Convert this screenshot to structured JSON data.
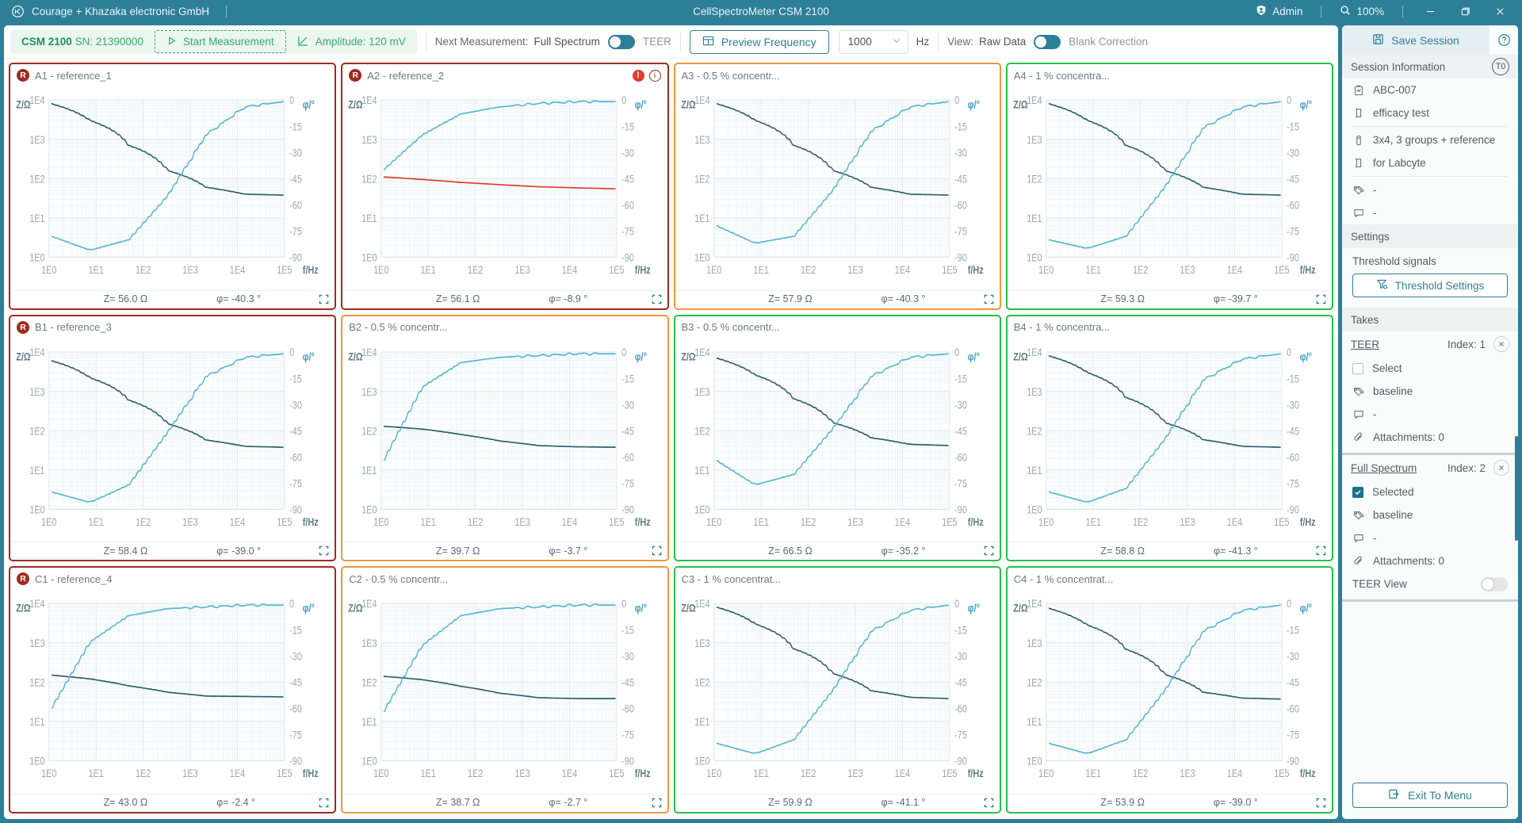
{
  "titlebar": {
    "company": "Courage + Khazaka electronic GmbH",
    "app_title": "CellSpectroMeter CSM 2100",
    "user": "Admin",
    "zoom": "100%",
    "minimize_icon": "minimize-icon",
    "maximize_icon": "maximize-icon",
    "close_icon": "close-icon"
  },
  "toolbar": {
    "device": "CSM 2100",
    "serial": "SN: 21390000",
    "start_label": "Start Measurement",
    "amplitude_label": "Amplitude: 120 mV",
    "next_measurement_label": "Next Measurement:",
    "next_measurement_left": "Full Spectrum",
    "next_measurement_right": "TEER",
    "preview_frequency_label": "Preview Frequency",
    "frequency_value": "1000",
    "frequency_unit": "Hz",
    "view_label": "View:",
    "view_left": "Raw Data",
    "view_right": "Blank Correction"
  },
  "sidebar": {
    "save_label": "Save Session",
    "help_icon": "help-icon",
    "session_information_title": "Session Information",
    "t0_badge": "T0",
    "info_rows": [
      {
        "icon": "study-icon",
        "text": "ABC-007"
      },
      {
        "icon": "note-icon",
        "text": "efficacy test"
      },
      {
        "icon": "plate-icon",
        "text": "3x4, 3 groups + reference"
      },
      {
        "icon": "note-icon",
        "text": "for Labcyte"
      },
      {
        "icon": "tag-icon",
        "text": "-"
      },
      {
        "icon": "comment-icon",
        "text": "-"
      }
    ],
    "settings_title": "Settings",
    "threshold_signals_label": "Threshold signals",
    "threshold_settings_label": "Threshold Settings",
    "takes_title": "Takes",
    "takes": [
      {
        "name": "TEER",
        "index_label": "Index: 1",
        "selected": false,
        "select_label": "Select",
        "tag": "baseline",
        "comment": "-",
        "attachments": "Attachments: 0"
      },
      {
        "name": "Full Spectrum",
        "index_label": "Index: 2",
        "selected": true,
        "select_label": "Selected",
        "tag": "baseline",
        "comment": "-",
        "attachments": "Attachments: 0",
        "teer_view_label": "TEER View",
        "teer_view_on": false
      }
    ],
    "exit_label": "Exit To Menu"
  },
  "chart_common": {
    "y_left_label": "Z/Ω",
    "y_right_label": "φ/°",
    "x_label": "f/Hz",
    "y_left_ticks": [
      "1E4",
      "1E3",
      "1E2",
      "1E1",
      "1E0"
    ],
    "y_right_ticks": [
      "0",
      "-15",
      "-30",
      "-45",
      "-60",
      "-75",
      "-90"
    ],
    "x_ticks": [
      "1E0",
      "1E1",
      "1E2",
      "1E3",
      "1E4",
      "1E5"
    ],
    "impedance_color": "#2b5e6b",
    "phase_color": "#55b4d4",
    "error_color": "#e03a2f"
  },
  "chart_data": {
    "type": "line",
    "title": "Impedance spectra grid — 12 wells (A1–C4)",
    "xlabel": "f/Hz",
    "ylabel": "Z/Ω",
    "y2label": "φ/°",
    "xlim": [
      1,
      100000
    ],
    "xscale": "log",
    "ylim": [
      1,
      10000
    ],
    "yscale": "log",
    "y2lim": [
      -90,
      0
    ],
    "grid": true,
    "legend": "none",
    "series_names": [
      "Z (impedance)",
      "φ (phase)"
    ],
    "panels": [
      {
        "id": "A1",
        "title": "A1 - reference_1",
        "badge": "R",
        "badge_visible": true,
        "border_color": "#9e2b1e",
        "status": "reference",
        "z_value": "Z= 56.0 Ω",
        "phase_value": "φ= -40.3 °",
        "error": false,
        "info": false,
        "impedance": [
          8000,
          3000,
          700,
          160,
          60,
          40,
          38
        ],
        "phase": [
          -78,
          -86,
          -80,
          -55,
          -20,
          -4,
          -1
        ]
      },
      {
        "id": "A2",
        "title": "A2 - reference_2",
        "badge": "R",
        "badge_visible": true,
        "border_color": "#9e2b1e",
        "status": "error",
        "z_value": "Z= 56.1 Ω",
        "phase_value": "φ= -8.9 °",
        "error": true,
        "info": true,
        "impedance": [
          110,
          95,
          80,
          70,
          62,
          58,
          55
        ],
        "phase": [
          -40,
          -20,
          -8,
          -4,
          -2,
          -1,
          -1
        ]
      },
      {
        "id": "A3",
        "title": "A3 - 0.5 % concentr...",
        "badge": "",
        "badge_visible": false,
        "border_color": "#f0973c",
        "status": "warning",
        "z_value": "Z= 57.9 Ω",
        "phase_value": "φ= -40.3 °",
        "error": false,
        "info": false,
        "impedance": [
          8000,
          3000,
          700,
          160,
          60,
          40,
          38
        ],
        "phase": [
          -72,
          -82,
          -78,
          -52,
          -18,
          -4,
          -1
        ]
      },
      {
        "id": "A4",
        "title": "A4 - 1 % concentra...",
        "badge": "",
        "badge_visible": false,
        "border_color": "#22c24a",
        "status": "ok",
        "z_value": "Z= 59.3 Ω",
        "phase_value": "φ= -39.7 °",
        "error": false,
        "info": false,
        "impedance": [
          8000,
          3000,
          700,
          160,
          60,
          40,
          38
        ],
        "phase": [
          -80,
          -85,
          -78,
          -50,
          -16,
          -4,
          -1
        ]
      },
      {
        "id": "B1",
        "title": "B1 - reference_3",
        "badge": "R",
        "badge_visible": true,
        "border_color": "#9e2b1e",
        "status": "reference",
        "z_value": "Z= 58.4 Ω",
        "phase_value": "φ= -39.0 °",
        "error": false,
        "info": false,
        "impedance": [
          6000,
          2200,
          600,
          150,
          58,
          40,
          38
        ],
        "phase": [
          -80,
          -86,
          -76,
          -46,
          -14,
          -3,
          -1
        ]
      },
      {
        "id": "B2",
        "title": "B2 - 0.5 % concentr...",
        "badge": "",
        "badge_visible": false,
        "border_color": "#f0973c",
        "status": "warning",
        "z_value": "Z= 39.7 Ω",
        "phase_value": "φ= -3.7 °",
        "error": false,
        "info": false,
        "impedance": [
          130,
          110,
          80,
          55,
          42,
          39,
          38
        ],
        "phase": [
          -62,
          -20,
          -6,
          -3,
          -2,
          -1,
          -1
        ]
      },
      {
        "id": "B3",
        "title": "B3 - 0.5 % concentr...",
        "badge": "",
        "badge_visible": false,
        "border_color": "#22c24a",
        "status": "ok",
        "z_value": "Z= 66.5 Ω",
        "phase_value": "φ= -35.2 °",
        "error": false,
        "info": false,
        "impedance": [
          7000,
          2600,
          650,
          160,
          66,
          45,
          42
        ],
        "phase": [
          -62,
          -76,
          -70,
          -44,
          -14,
          -3,
          -1
        ]
      },
      {
        "id": "B4",
        "title": "B4 - 1 % concentra...",
        "badge": "",
        "badge_visible": false,
        "border_color": "#22c24a",
        "status": "ok",
        "z_value": "Z= 58.8 Ω",
        "phase_value": "φ= -41.3 °",
        "error": false,
        "info": false,
        "impedance": [
          8000,
          3000,
          700,
          160,
          59,
          40,
          38
        ],
        "phase": [
          -80,
          -86,
          -78,
          -50,
          -16,
          -4,
          -1
        ]
      },
      {
        "id": "C1",
        "title": "C1 - reference_4",
        "badge": "R",
        "badge_visible": true,
        "border_color": "#9e2b1e",
        "status": "reference",
        "z_value": "Z= 43.0 Ω",
        "phase_value": "φ= -2.4 °",
        "error": false,
        "info": false,
        "impedance": [
          150,
          120,
          80,
          55,
          44,
          43,
          42
        ],
        "phase": [
          -60,
          -22,
          -7,
          -3,
          -2,
          -1,
          -1
        ]
      },
      {
        "id": "C2",
        "title": "C2 - 0.5 % concentr...",
        "badge": "",
        "badge_visible": false,
        "border_color": "#f0973c",
        "status": "warning",
        "z_value": "Z= 38.7 Ω",
        "phase_value": "φ= -2.7 °",
        "error": false,
        "info": false,
        "impedance": [
          140,
          115,
          78,
          52,
          40,
          38,
          38
        ],
        "phase": [
          -62,
          -24,
          -7,
          -3,
          -2,
          -1,
          -1
        ]
      },
      {
        "id": "C3",
        "title": "C3 - 1 % concentrat...",
        "badge": "",
        "badge_visible": false,
        "border_color": "#22c24a",
        "status": "ok",
        "z_value": "Z= 59.9 Ω",
        "phase_value": "φ= -41.1 °",
        "error": false,
        "info": false,
        "impedance": [
          8000,
          3000,
          700,
          165,
          60,
          41,
          38
        ],
        "phase": [
          -80,
          -86,
          -78,
          -50,
          -16,
          -4,
          -1
        ]
      },
      {
        "id": "C4",
        "title": "C4 - 1 % concentrat...",
        "badge": "",
        "badge_visible": false,
        "border_color": "#22c24a",
        "status": "ok",
        "z_value": "Z= 53.9 Ω",
        "phase_value": "φ= -39.0 °",
        "error": false,
        "info": false,
        "impedance": [
          7500,
          2800,
          680,
          155,
          55,
          39,
          37
        ],
        "phase": [
          -80,
          -86,
          -78,
          -50,
          -16,
          -4,
          -1
        ]
      }
    ]
  }
}
